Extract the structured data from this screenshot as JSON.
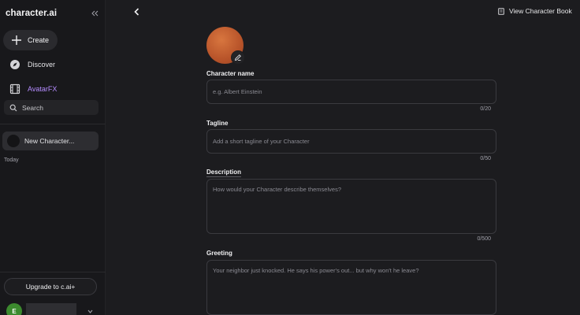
{
  "sidebar": {
    "logo": "character.ai",
    "create_label": "Create",
    "nav": {
      "discover_label": "Discover",
      "avatarfx_label": "AvatarFX"
    },
    "search_placeholder": "Search",
    "chat_item_label": "New Character...",
    "section_today": "Today",
    "upgrade_label": "Upgrade to c.ai+",
    "user_initial": "E"
  },
  "header": {
    "view_book_label": "View Character Book"
  },
  "form": {
    "name": {
      "label": "Character name",
      "placeholder": "e.g. Albert Einstein",
      "counter": "0/20"
    },
    "tagline": {
      "label": "Tagline",
      "placeholder": "Add a short tagline of your Character",
      "counter": "0/50"
    },
    "description": {
      "label": "Description",
      "placeholder": "How would your Character describe themselves?",
      "counter": "0/500"
    },
    "greeting": {
      "label": "Greeting",
      "placeholder": "Your neighbor just knocked. He says his power's out... but why won't he leave?"
    }
  },
  "colors": {
    "accent_purple": "#b58cff",
    "avatar_orange": "#c45f30",
    "user_avatar_green": "#3c8a2e"
  }
}
